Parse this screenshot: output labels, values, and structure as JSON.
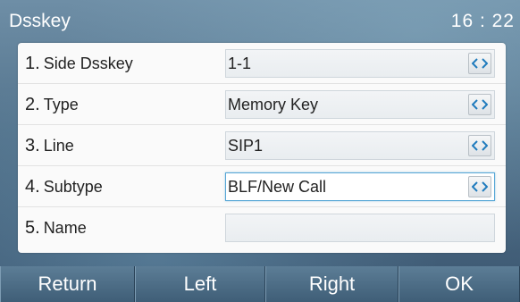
{
  "title_bar": {
    "title": "Dsskey",
    "time": "16 : 22"
  },
  "rows": [
    {
      "num": "1.",
      "label": "Side Dsskey",
      "value": "1-1",
      "has_toggle": true,
      "focused": false
    },
    {
      "num": "2.",
      "label": "Type",
      "value": "Memory Key",
      "has_toggle": true,
      "focused": false
    },
    {
      "num": "3.",
      "label": "Line",
      "value": "SIP1",
      "has_toggle": true,
      "focused": false
    },
    {
      "num": "4.",
      "label": "Subtype",
      "value": "BLF/New Call",
      "has_toggle": true,
      "focused": true
    },
    {
      "num": "5.",
      "label": "Name",
      "value": "",
      "has_toggle": false,
      "focused": false
    }
  ],
  "softkeys": [
    "Return",
    "Left",
    "Right",
    "OK"
  ],
  "icons": {
    "toggle": "left-right-arrows-icon"
  },
  "colors": {
    "toggle_arrow": "#1f7bbd",
    "focus_border": "#57a7d6"
  }
}
